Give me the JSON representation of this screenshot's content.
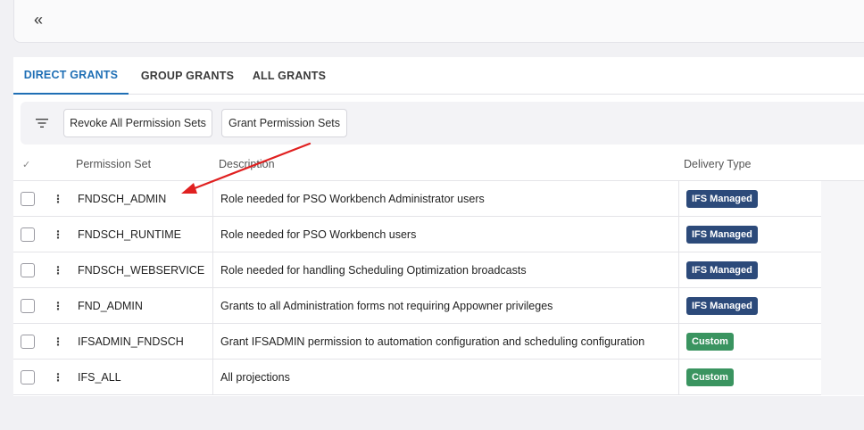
{
  "topbar": {
    "collapse_icon": "double-chevron-left-icon",
    "collapse_glyph": "«"
  },
  "tabs": [
    {
      "label": "DIRECT GRANTS",
      "active": true
    },
    {
      "label": "GROUP GRANTS",
      "active": false
    },
    {
      "label": "ALL GRANTS",
      "active": false
    }
  ],
  "toolbar": {
    "filter_icon": "filter-icon",
    "revoke_label": "Revoke All Permission Sets",
    "grant_label": "Grant Permission Sets"
  },
  "table": {
    "select_all_glyph": "✓",
    "headers": {
      "permission_set": "Permission Set",
      "description": "Description",
      "delivery_type": "Delivery Type"
    },
    "rows": [
      {
        "permission_set": "FNDSCH_ADMIN",
        "description": "Role needed for PSO Workbench Administrator users",
        "delivery_type": "IFS Managed"
      },
      {
        "permission_set": "FNDSCH_RUNTIME",
        "description": "Role needed for PSO Workbench users",
        "delivery_type": "IFS Managed"
      },
      {
        "permission_set": "FNDSCH_WEBSERVICE",
        "description": "Role needed for handling Scheduling Optimization broadcasts",
        "delivery_type": "IFS Managed"
      },
      {
        "permission_set": "FND_ADMIN",
        "description": "Grants to all Administration forms not requiring Appowner privileges",
        "delivery_type": "IFS Managed"
      },
      {
        "permission_set": "IFSADMIN_FNDSCH",
        "description": "Grant IFSADMIN permission to automation configuration and scheduling configuration",
        "delivery_type": "Custom"
      },
      {
        "permission_set": "IFS_ALL",
        "description": "All projections",
        "delivery_type": "Custom"
      }
    ],
    "kebab_glyph": "⋮"
  },
  "colors": {
    "accent": "#1f6fb5",
    "badge_ifs_managed": "#2c4a7a",
    "badge_custom": "#3a9460",
    "annotation_arrow": "#e02020"
  }
}
